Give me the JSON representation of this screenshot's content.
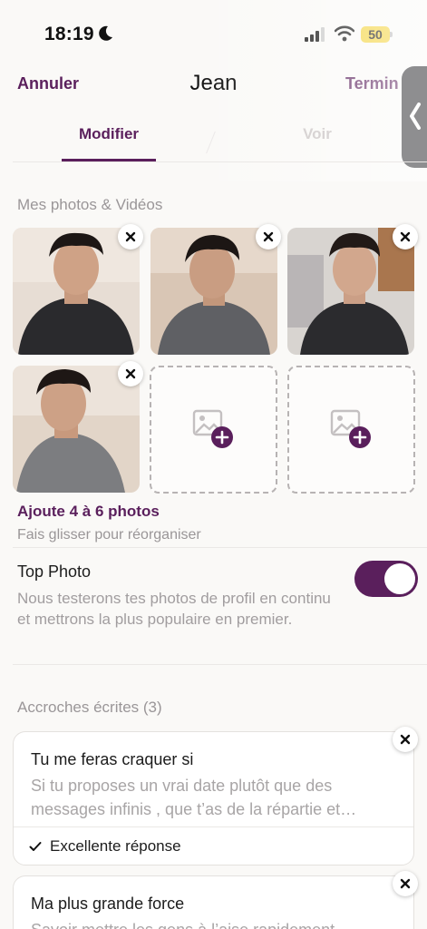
{
  "status_bar": {
    "time": "18:19",
    "battery": "50"
  },
  "header": {
    "cancel_label": "Annuler",
    "title": "Jean",
    "done_label": "Termin"
  },
  "tabs": [
    {
      "label": "Modifier"
    },
    {
      "label": "Voir"
    }
  ],
  "photos_section": {
    "title": "Mes photos & Vidéos",
    "add_title": "Ajoute 4 à 6 photos",
    "hint": "Fais glisser pour réorganiser"
  },
  "top_photo": {
    "title": "Top Photo",
    "description": "Nous testerons tes photos de profil en continu et mettrons la plus populaire en premier.",
    "enabled": true
  },
  "prompts_section": {
    "title": "Accroches écrites (3)",
    "items": [
      {
        "question": "Tu me feras craquer si",
        "answer": "Si tu proposes un vrai date plutôt que des messages infinis , que t’as de la répartie et…",
        "badge": "Excellente réponse"
      },
      {
        "question": "Ma plus grande force",
        "answer": "Savoir mettre les gens à l’aise rapidement"
      }
    ]
  },
  "colors": {
    "accent": "#5a1f5c",
    "muted_text": "#9a9698",
    "background": "#faf9f7"
  }
}
